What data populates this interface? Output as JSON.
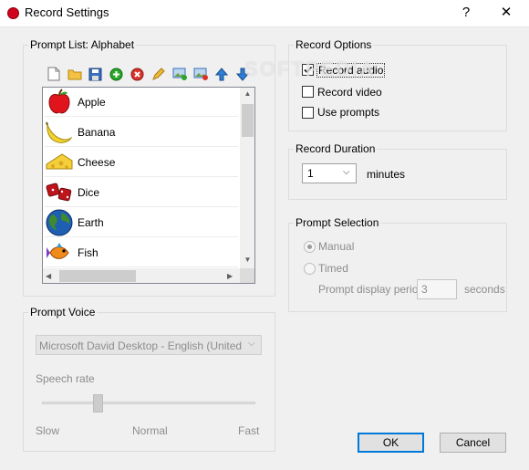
{
  "window": {
    "title": "Record Settings",
    "help_glyph": "?",
    "close_glyph": "✕"
  },
  "prompt_list": {
    "title": "Prompt List: Alphabet",
    "toolbar": [
      "new-icon",
      "open-folder-icon",
      "save-icon",
      "add-icon",
      "remove-icon",
      "edit-pencil-icon",
      "add-image-icon",
      "remove-image-icon",
      "move-up-icon",
      "move-down-icon"
    ],
    "items": [
      {
        "label": "Apple",
        "icon": "apple-icon"
      },
      {
        "label": "Banana",
        "icon": "banana-icon"
      },
      {
        "label": "Cheese",
        "icon": "cheese-icon"
      },
      {
        "label": "Dice",
        "icon": "dice-icon"
      },
      {
        "label": "Earth",
        "icon": "earth-icon"
      },
      {
        "label": "Fish",
        "icon": "fish-icon"
      }
    ]
  },
  "record_options": {
    "title": "Record Options",
    "record_audio": {
      "label": "Record audio",
      "checked": true
    },
    "record_video": {
      "label": "Record video",
      "checked": false
    },
    "use_prompts": {
      "label": "Use prompts",
      "checked": false
    }
  },
  "record_duration": {
    "title": "Record Duration",
    "value": "1",
    "unit": "minutes"
  },
  "prompt_selection": {
    "title": "Prompt Selection",
    "manual_label": "Manual",
    "timed_label": "Timed",
    "selected": "Manual",
    "period_label": "Prompt display period:",
    "period_value": "3",
    "period_unit": "seconds"
  },
  "prompt_voice": {
    "title": "Prompt Voice",
    "voice": "Microsoft David Desktop - English (United State",
    "rate_label": "Speech rate",
    "rate_slow": "Slow",
    "rate_normal": "Normal",
    "rate_fast": "Fast",
    "rate_level": 0.25
  },
  "buttons": {
    "ok": "OK",
    "cancel": "Cancel"
  },
  "watermark": "SOFTPEDIA",
  "colors": {
    "accent": "#0078d7",
    "title_icon": "#d0021b"
  }
}
